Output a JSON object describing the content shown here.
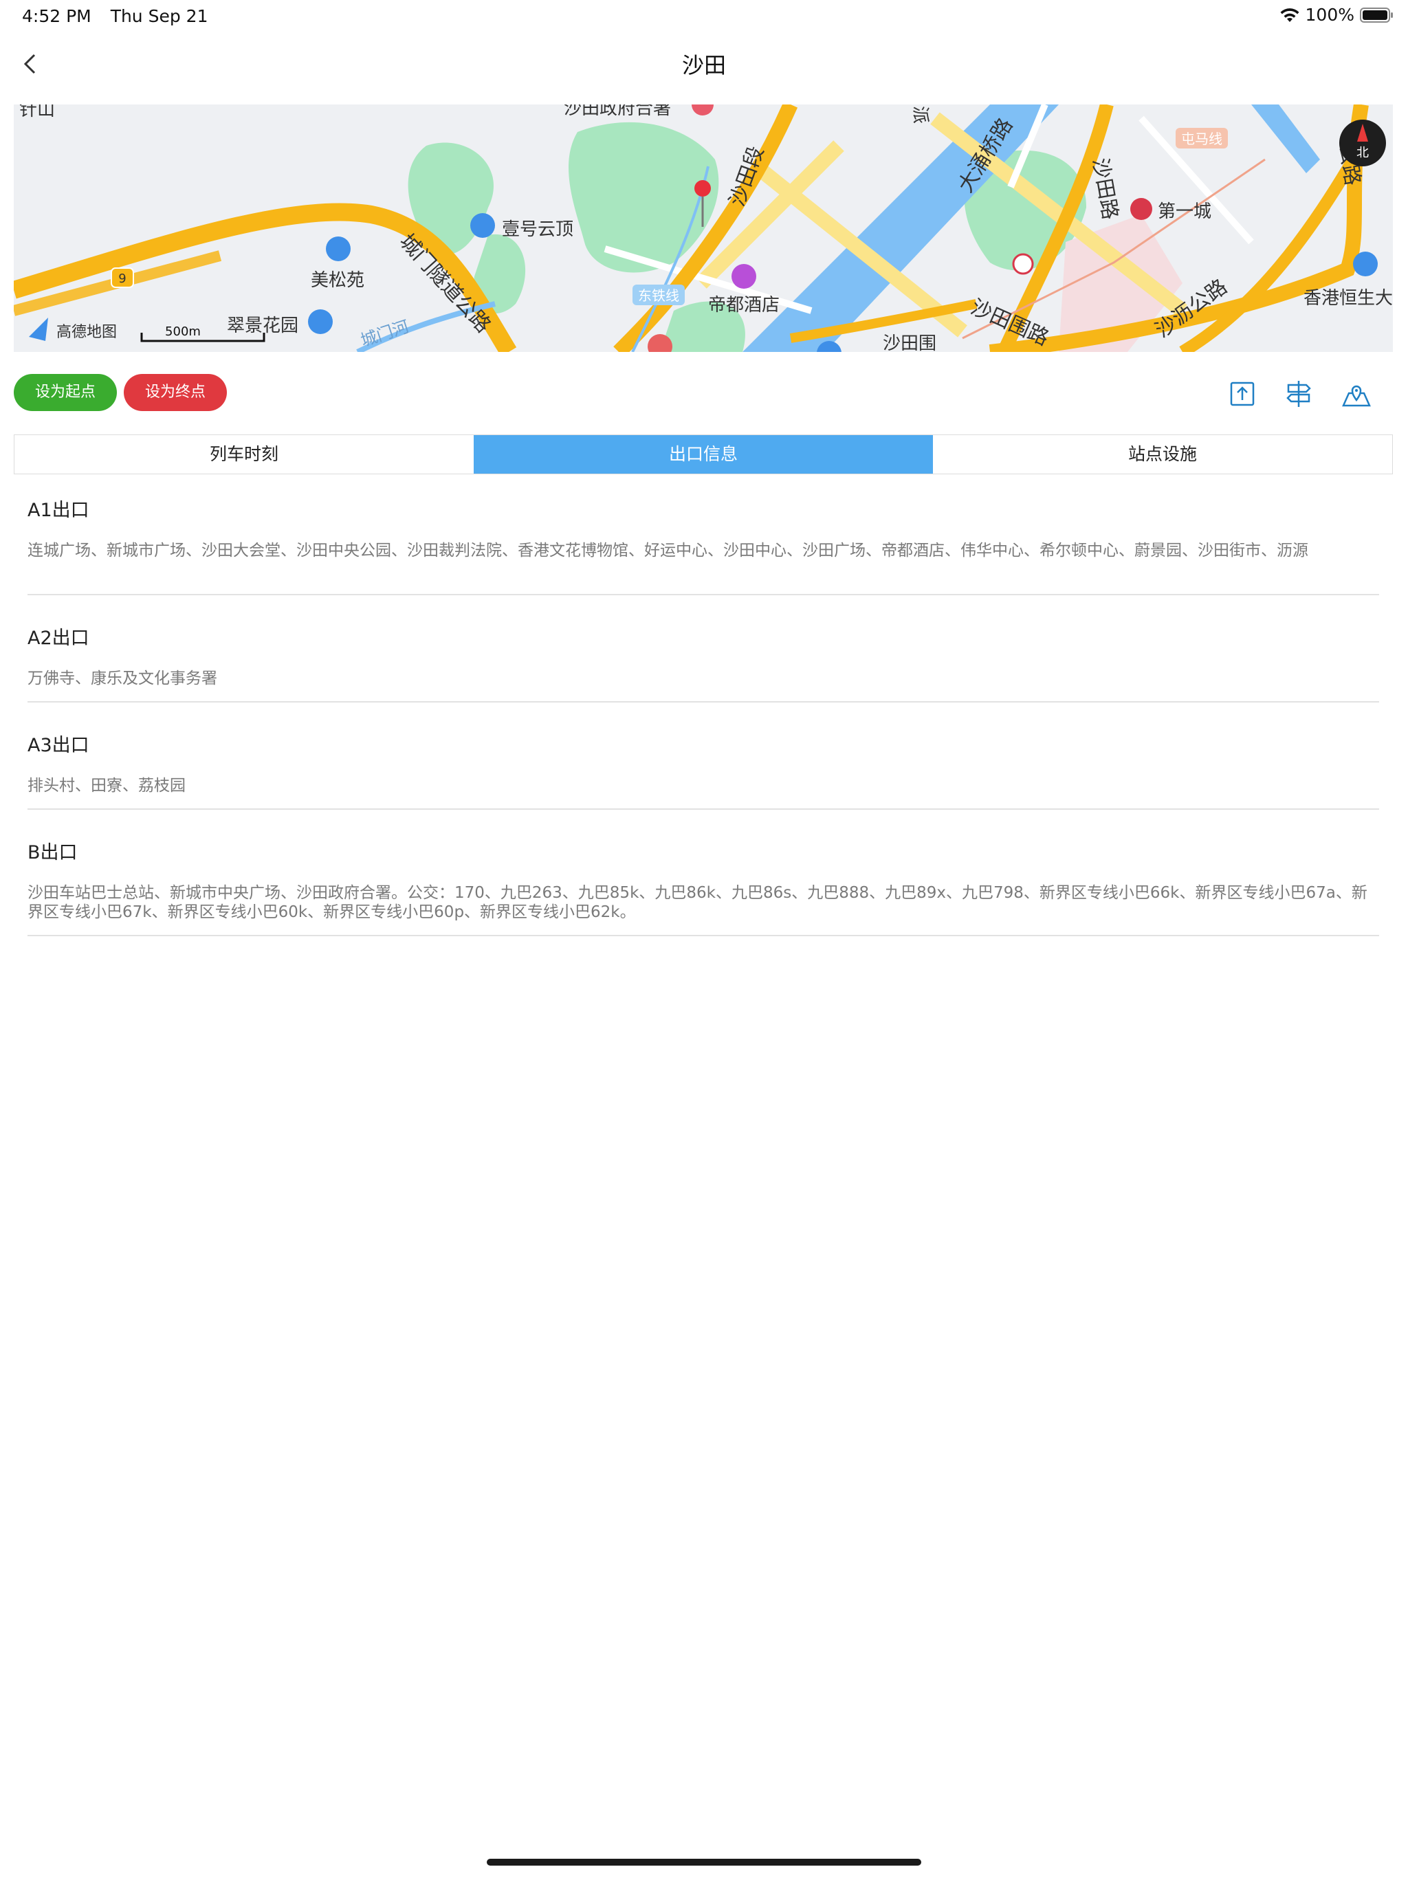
{
  "status_bar": {
    "time": "4:52 PM",
    "date": "Thu Sep 21",
    "battery": "100%"
  },
  "nav": {
    "title": "沙田"
  },
  "map": {
    "labels": {
      "hill": "针山",
      "gov": "沙田政府合署",
      "yihao": "壹号云顶",
      "meisong": "美松苑",
      "cuijing": "翠景花园",
      "chengmen_tunnel": "城门隧道公路",
      "chengmen_river": "城门河",
      "dongtie": "东铁线",
      "didu": "帝都酒店",
      "tianwei": "沙田围",
      "shatian_rd": "沙田围路",
      "dayong": "大涌桥路",
      "shatian_road": "沙田路",
      "diyicheng": "第一城",
      "tuenma": "屯马线",
      "shali": "沙沥公路",
      "hsu": "香港恒生大",
      "shatian_seg": "沙田段",
      "route9": "9",
      "pai": "派",
      "gongl": "公路",
      "compass": "北",
      "scale": "500m",
      "brand": "高德地图"
    }
  },
  "actions": {
    "start": "设为起点",
    "end": "设为终点"
  },
  "tabs": [
    {
      "label": "列车时刻"
    },
    {
      "label": "出口信息"
    },
    {
      "label": "站点设施"
    }
  ],
  "exits": [
    {
      "name": "A1出口",
      "desc": "连城广场、新城市广场、沙田大会堂、沙田中央公园、沙田裁判法院、香港文花博物馆、好运中心、沙田中心、沙田广场、帝都酒店、伟华中心、希尔顿中心、蔚景园、沙田街市、沥源"
    },
    {
      "name": "A2出口",
      "desc": "万佛寺、康乐及文化事务署"
    },
    {
      "name": "A3出口",
      "desc": "排头村、田寮、荔枝园"
    },
    {
      "name": "B出口",
      "desc": "沙田车站巴士总站、新城市中央广场、沙田政府合署。公交：170、九巴263、九巴85k、九巴86k、九巴86s、九巴888、九巴89x、九巴798、新界区专线小巴66k、新界区专线小巴67a、新界区专线小巴67k、新界区专线小巴60k、新界区专线小巴60p、新界区专线小巴62k。"
    }
  ]
}
